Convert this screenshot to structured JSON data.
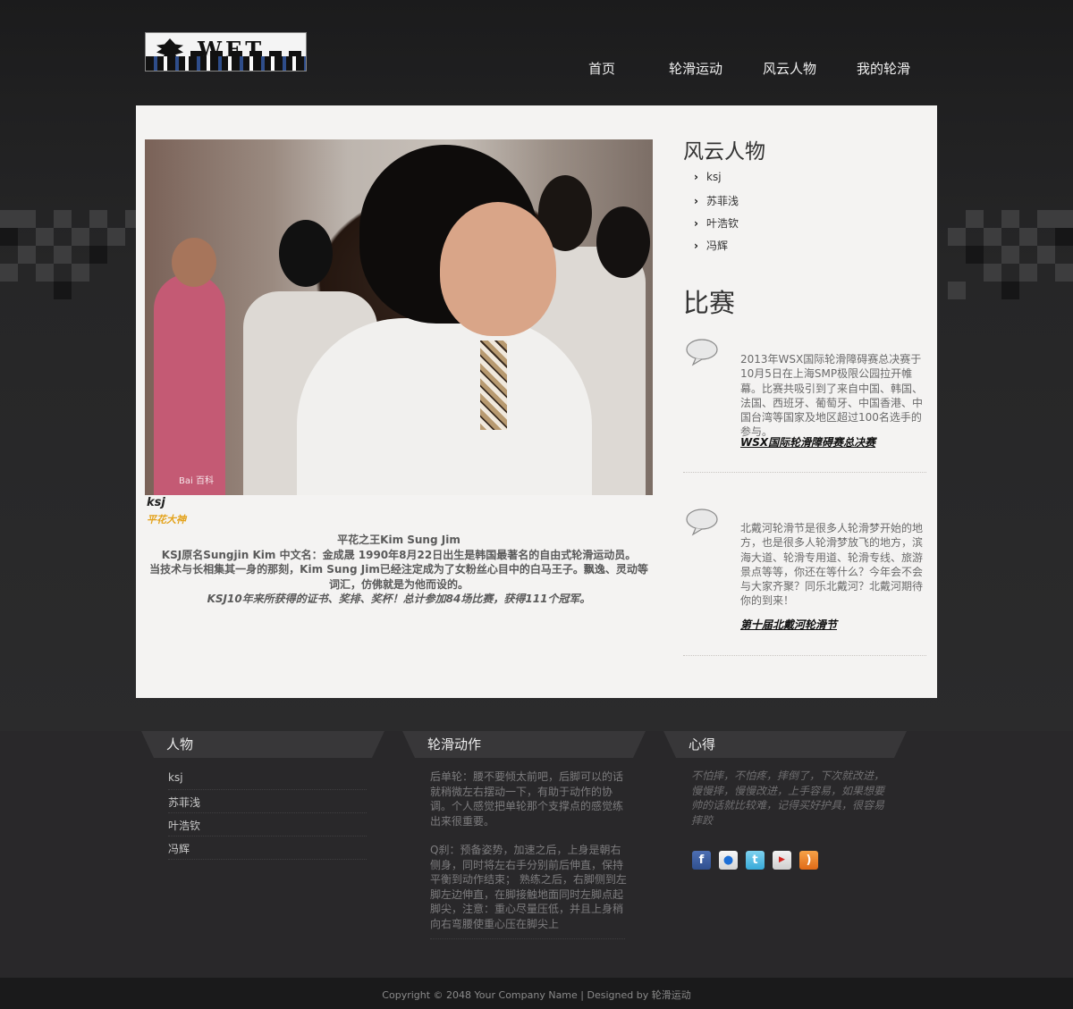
{
  "nav": [
    "首页",
    "轮滑运动",
    "风云人物",
    "我的轮滑"
  ],
  "logo_text": "WET",
  "hero": {
    "watermark": "Bai 百科",
    "caption_name": "ksj",
    "caption_sub": "平花大神",
    "bio": [
      "平花之王Kim Sung Jim",
      "KSJ原名Sungjin Kim 中文名：金成晟 1990年8月22日出生是韩国最著名的自由式轮滑运动员。",
      "当技术与长相集其一身的那刻，Kim Sung Jim已经注定成为了女粉丝心目中的白马王子。飘逸、灵动等词汇，仿佛就是为他而设的。"
    ],
    "bio_italic": "KSJ10年来所获得的证书、奖排、奖杯！总计参加84场比赛，获得111个冠军。"
  },
  "sidebar": {
    "people_title": "风云人物",
    "people": [
      "ksj",
      "苏菲浅",
      "叶浩钦",
      "冯辉"
    ],
    "match_title": "比赛",
    "events": [
      {
        "text": "2013年WSX国际轮滑障碍赛总决赛于10月5日在上海SMP极限公园拉开帷幕。比赛共吸引到了来自中国、韩国、法国、西班牙、葡萄牙、中国香港、中国台湾等国家及地区超过100名选手的参与。",
        "title": "WSX国际轮滑障碍赛总决赛"
      },
      {
        "text": "北戴河轮滑节是很多人轮滑梦开始的地方，也是很多人轮滑梦放飞的地方，滨海大道、轮滑专用道、轮滑专线、旅游景点等等，你还在等什么？今年会不会与大家齐聚？同乐北戴河？北戴河期待你的到来！",
        "title": "第十届北戴河轮滑节"
      }
    ]
  },
  "footer": {
    "col1_title": "人物",
    "col1_items": [
      "ksj",
      "苏菲浅",
      "叶浩钦",
      "冯辉"
    ],
    "col2_title": "轮滑动作",
    "col2_paras": [
      "后单轮：腰不要倾太前吧，后脚可以的话就稍微左右摆动一下，有助于动作的协调。个人感觉把单轮那个支撑点的感觉练出来很重要。",
      "Q刹：预备姿势，加速之后，上身是朝右侧身，同时将左右手分别前后伸直，保持平衡到动作结束； 熟练之后，右脚侧到左脚左边伸直，在脚接触地面同时左脚点起脚尖，注意：重心尽量压低，并且上身稍向右弯腰使重心压在脚尖上"
    ],
    "col3_title": "心得",
    "col3_text": "不怕摔，不怕疼，摔倒了，下次就改进，慢慢摔，慢慢改进，上手容易，如果想要帅的话就比较难，记得买好护具，很容易摔跤",
    "social_icons": [
      "facebook-icon",
      "flickr-icon",
      "twitter-icon",
      "youtube-icon",
      "rss-icon"
    ]
  },
  "copyright": "Copyright © 2048 Your Company Name | Designed by 轮滑运动"
}
